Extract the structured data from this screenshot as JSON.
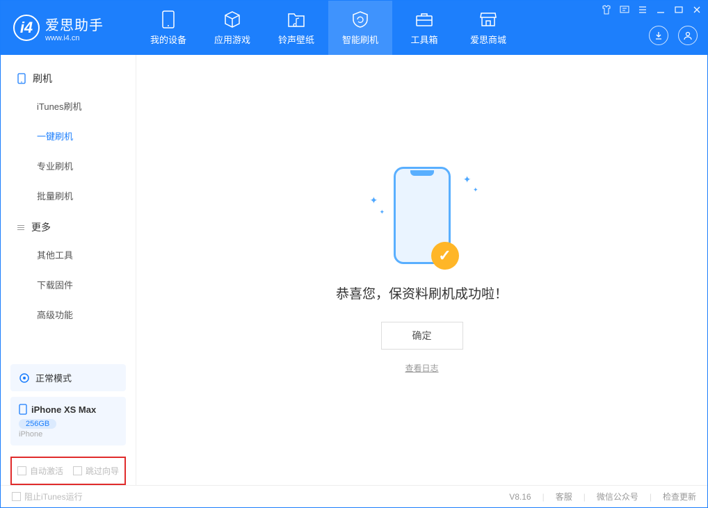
{
  "app": {
    "name_cn": "爱思助手",
    "name_en": "www.i4.cn"
  },
  "nav": [
    {
      "label": "我的设备"
    },
    {
      "label": "应用游戏"
    },
    {
      "label": "铃声壁纸"
    },
    {
      "label": "智能刷机"
    },
    {
      "label": "工具箱"
    },
    {
      "label": "爱思商城"
    }
  ],
  "sidebar": {
    "section1_title": "刷机",
    "items1": [
      "iTunes刷机",
      "一键刷机",
      "专业刷机",
      "批量刷机"
    ],
    "section2_title": "更多",
    "items2": [
      "其他工具",
      "下载固件",
      "高级功能"
    ]
  },
  "mode": {
    "label": "正常模式"
  },
  "device": {
    "name": "iPhone XS Max",
    "storage": "256GB",
    "sub": "iPhone"
  },
  "options": {
    "auto_activate": "自动激活",
    "skip_guide": "跳过向导"
  },
  "content": {
    "success_msg": "恭喜您，保资料刷机成功啦！",
    "ok": "确定",
    "view_log": "查看日志"
  },
  "footer": {
    "block_itunes": "阻止iTunes运行",
    "version": "V8.16",
    "support": "客服",
    "wechat": "微信公众号",
    "update": "检查更新"
  }
}
